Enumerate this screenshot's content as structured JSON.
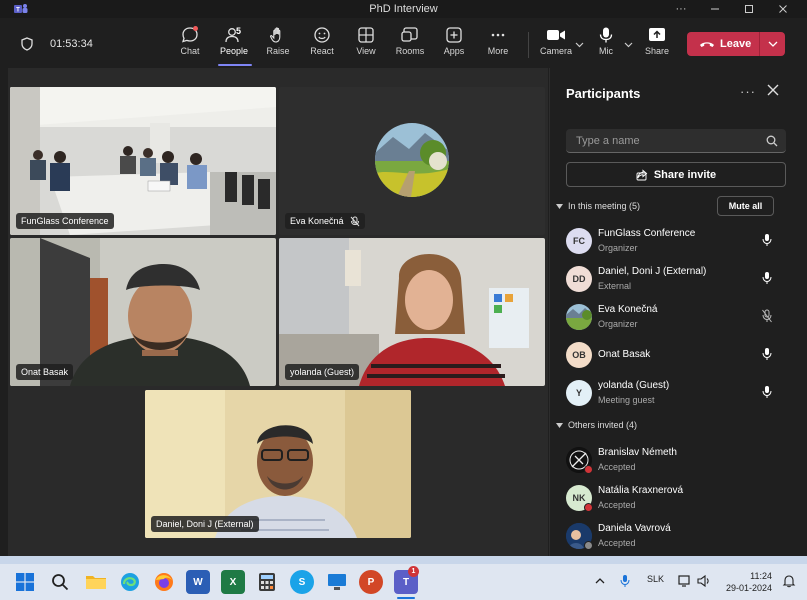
{
  "window": {
    "title": "PhD Interview"
  },
  "toolbar": {
    "timer": "01:53:34",
    "people_count": "5",
    "buttons": {
      "chat": "Chat",
      "people": "People",
      "raise": "Raise",
      "react": "React",
      "view": "View",
      "rooms": "Rooms",
      "apps": "Apps",
      "more": "More",
      "camera": "Camera",
      "mic": "Mic",
      "share": "Share",
      "leave": "Leave"
    }
  },
  "tiles": [
    {
      "name": "FunGlass Conference",
      "muted": false
    },
    {
      "name": "Eva Konečná",
      "muted": true
    },
    {
      "name": "Onat Basak",
      "muted": false
    },
    {
      "name": "yolanda (Guest)",
      "muted": false
    },
    {
      "name": "Daniel, Doni J (External)",
      "muted": false
    }
  ],
  "panel": {
    "title": "Participants",
    "search_placeholder": "Type a name",
    "share_invite": "Share invite",
    "in_meeting_label": "In this meeting (5)",
    "mute_all": "Mute all",
    "others_label": "Others invited (4)",
    "in_meeting": [
      {
        "initials": "FC",
        "name": "FunGlass Conference",
        "role": "Organizer",
        "avatar_bg": "#dcdcf0",
        "muted": false
      },
      {
        "initials": "DD",
        "name": "Daniel, Doni J (External)",
        "role": "External",
        "avatar_bg": "#f0ddd6",
        "muted": false
      },
      {
        "initials": "",
        "name": "Eva Konečná",
        "role": "Organizer",
        "avatar_bg": "#6a8f4a",
        "muted": true
      },
      {
        "initials": "OB",
        "name": "Onat Basak",
        "role": "",
        "avatar_bg": "#f3dcc8",
        "muted": false
      },
      {
        "initials": "Y",
        "name": "yolanda (Guest)",
        "role": "Meeting guest",
        "avatar_bg": "#e3f0f7",
        "muted": false
      }
    ],
    "others": [
      {
        "initials": "",
        "name": "Branislav Németh",
        "role": "Accepted",
        "avatar_bg": "#111111",
        "status_color": "#d13438"
      },
      {
        "initials": "NK",
        "name": "Natália Kraxnerová",
        "role": "Accepted",
        "avatar_bg": "#d7ead0",
        "status_color": "#d13438"
      },
      {
        "initials": "",
        "name": "Daniela Vavrová",
        "role": "Accepted",
        "avatar_bg": "#1a3a6a",
        "status_color": "#8a8a8a"
      }
    ]
  },
  "taskbar": {
    "language": "SLK",
    "time": "11:24",
    "date": "29-01-2024",
    "teams_badge": "1"
  },
  "colors": {
    "accent": "#7f85f5",
    "leave": "#c4314b",
    "panel_bg": "#1f1f1f",
    "taskbar_bg": "#dfe6f1"
  }
}
